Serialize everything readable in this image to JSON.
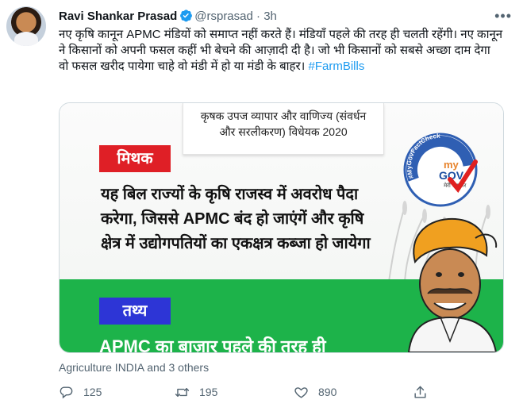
{
  "tweet": {
    "author_name": "Ravi Shankar Prasad",
    "handle": "@rsprasad",
    "separator": "·",
    "time": "3h",
    "body": "नए कृषि कानून APMC मंडियों को समाप्त नहीं करते हैं। मंडियाँ पहले की तरह ही चलती रहेंगी। नए कानून ने किसानों को अपनी फसल कहीं भी बेचने की आज़ादी दी है। जो भी किसानों को सबसे अच्छा दाम देगा वो फसल खरीद पायेगा चाहे वो मंडी में हो या मंडी के बाहर।",
    "hashtag": "#FarmBills",
    "more_icon": "more-icon"
  },
  "card": {
    "title_line1": "कृषक उपज व्यापार और वाणिज्य (संवर्धन",
    "title_line2": "और सरलीकरण) विधेयक 2020",
    "myth_label": "मिथक",
    "myth_text": "यह बिल राज्यों के कृषि राजस्व में अवरोध पैदा करेगा, जिससे APMC बंद हो जाएंगें और कृषि क्षेत्र में उद्योगपतियों का एकक्षत्र कब्जा हो जायेगा",
    "fact_label": "तथ्य",
    "fact_text": "APMC का बाज़ार पहले की तरह ही",
    "badge_arc": "#MyGovFactCheck",
    "badge_my": "my",
    "badge_gov": "GOV",
    "badge_sub": "मेरी सरकार",
    "colors": {
      "myth": "#df1f26",
      "fact": "#2d35d6",
      "band": "#1db34a"
    }
  },
  "social_context": "Agriculture INDIA and 3 others",
  "actions": {
    "replies": "125",
    "retweets": "195",
    "likes": "890"
  }
}
